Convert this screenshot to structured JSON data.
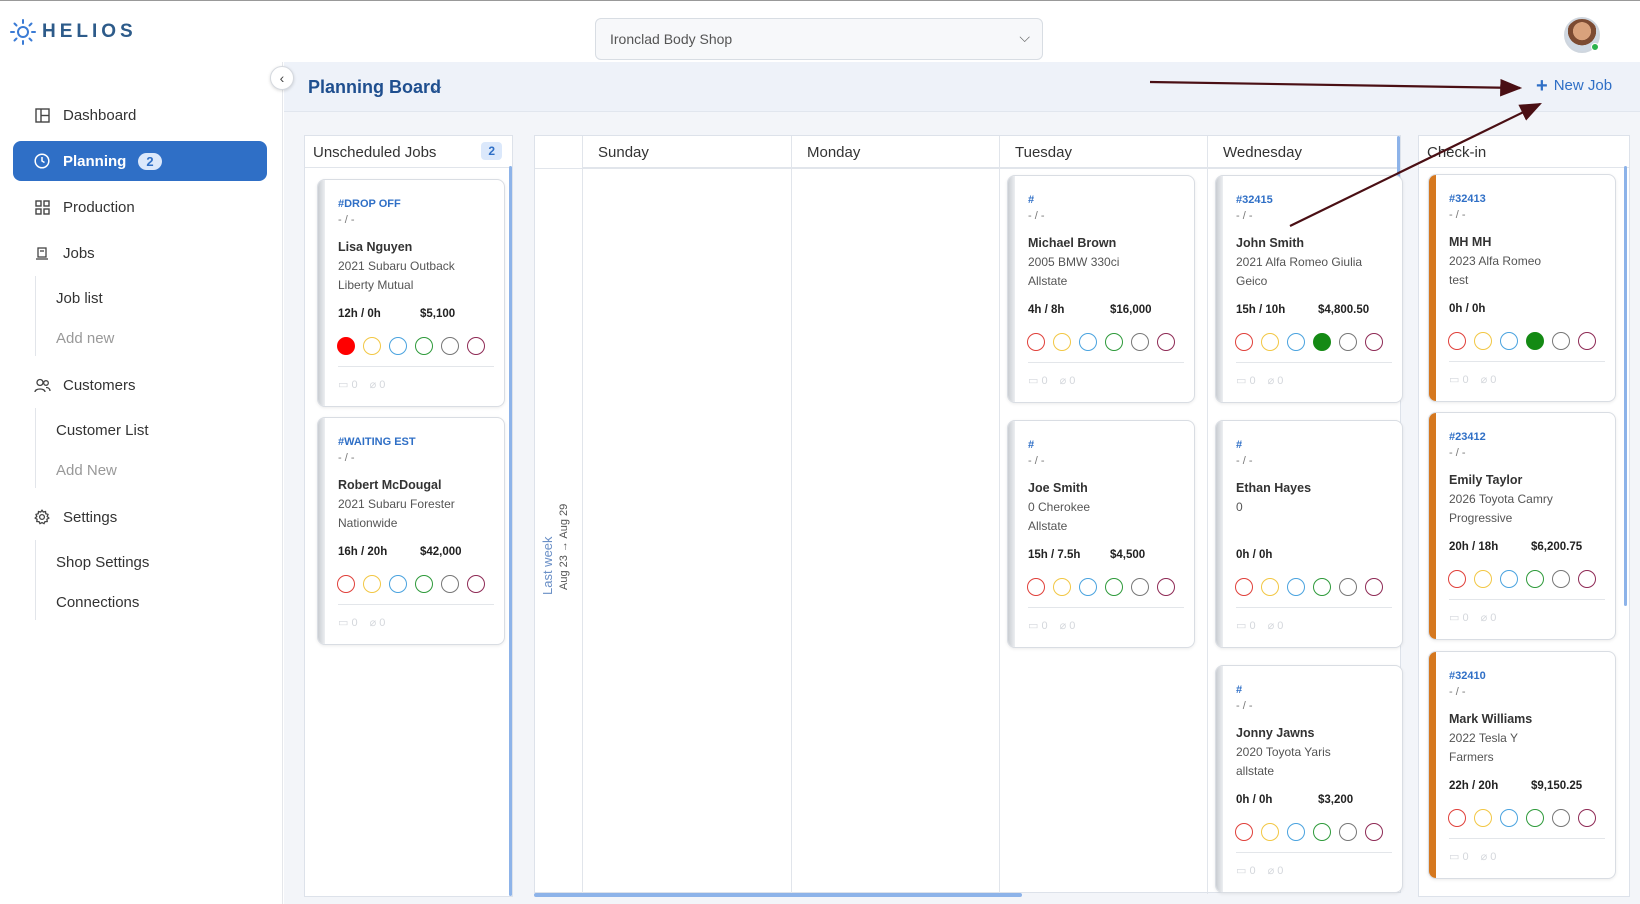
{
  "app": {
    "name": "HELIOS"
  },
  "topbar": {
    "shop": "Ironclad Body Shop"
  },
  "sidebar": {
    "dashboard": "Dashboard",
    "planning": "Planning",
    "planning_badge": "2",
    "production": "Production",
    "jobs": "Jobs",
    "job_list": "Job list",
    "jobs_add_new": "Add new",
    "customers": "Customers",
    "customer_list": "Customer List",
    "customers_add_new": "Add New",
    "settings": "Settings",
    "shop_settings": "Shop Settings",
    "connections": "Connections"
  },
  "main": {
    "title": "Planning Board",
    "new_job": "New Job",
    "unscheduled_title": "Unscheduled Jobs",
    "unscheduled_count": "2",
    "days": [
      "Sunday",
      "Monday",
      "Tuesday",
      "Wednesday"
    ],
    "checkin_title": "Check-in",
    "week_label": "Last week",
    "week_range": "Aug 23 → Aug 29"
  },
  "colors": {
    "accent": "#2f6fc6",
    "dot_red": "#e0403a",
    "dot_yellow": "#f2c744",
    "dot_blue": "#4aa3df",
    "dot_green": "#2e9a3a",
    "dot_gray": "#777777",
    "dot_purple": "#8e2a55",
    "filled_red": "#ff0000",
    "filled_green": "#148a14",
    "orange_edge": "#d5781f"
  },
  "cards": {
    "u1": {
      "ro": "#DROP OFF",
      "dash": "- / -",
      "name": "Lisa Nguyen",
      "vehicle": "2021 Subaru Outback",
      "insurer": "Liberty Mutual",
      "hours": "12h / 0h",
      "amount": "$5,100",
      "comments": "0",
      "attachments": "0"
    },
    "u2": {
      "ro": "#WAITING EST",
      "dash": "- / -",
      "name": "Robert McDougal",
      "vehicle": "2021 Subaru Forester",
      "insurer": "Nationwide",
      "hours": "16h / 20h",
      "amount": "$42,000",
      "comments": "0",
      "attachments": "0"
    },
    "t1": {
      "ro": "#",
      "dash": "- / -",
      "name": "Michael Brown",
      "vehicle": "2005 BMW 330ci",
      "insurer": "Allstate",
      "hours": "4h / 8h",
      "amount": "$16,000",
      "comments": "0",
      "attachments": "0"
    },
    "t2": {
      "ro": "#",
      "dash": "- / -",
      "name": "Joe Smith",
      "vehicle": "0 Cherokee",
      "insurer": "Allstate",
      "hours": "15h / 7.5h",
      "amount": "$4,500",
      "comments": "0",
      "attachments": "0"
    },
    "w1": {
      "ro": "#32415",
      "dash": "- / -",
      "name": "John Smith",
      "vehicle": "2021 Alfa Romeo Giulia",
      "insurer": "Geico",
      "hours": "15h / 10h",
      "amount": "$4,800.50",
      "comments": "0",
      "attachments": "0"
    },
    "w2": {
      "ro": "#",
      "dash": "- / -",
      "name": "Ethan Hayes",
      "vehicle": "0",
      "insurer": "",
      "hours": "0h / 0h",
      "amount": "",
      "comments": "0",
      "attachments": "0"
    },
    "w3": {
      "ro": "#",
      "dash": "- / -",
      "name": "Jonny Jawns",
      "vehicle": "2020 Toyota Yaris",
      "insurer": "allstate",
      "hours": "0h / 0h",
      "amount": "$3,200",
      "comments": "0",
      "attachments": "0"
    },
    "c1": {
      "ro": "#32413",
      "dash": "- / -",
      "name": "MH MH",
      "vehicle": "2023 Alfa Romeo",
      "insurer": "test",
      "hours": "0h / 0h",
      "amount": "",
      "comments": "0",
      "attachments": "0"
    },
    "c2": {
      "ro": "#23412",
      "dash": "- / -",
      "name": "Emily Taylor",
      "vehicle": "2026 Toyota Camry",
      "insurer": "Progressive",
      "hours": "20h / 18h",
      "amount": "$6,200.75",
      "comments": "0",
      "attachments": "0"
    },
    "c3": {
      "ro": "#32410",
      "dash": "- / -",
      "name": "Mark Williams",
      "vehicle": "2022 Tesla Y",
      "insurer": "Farmers",
      "hours": "22h / 20h",
      "amount": "$9,150.25",
      "comments": "0",
      "attachments": "0"
    }
  }
}
